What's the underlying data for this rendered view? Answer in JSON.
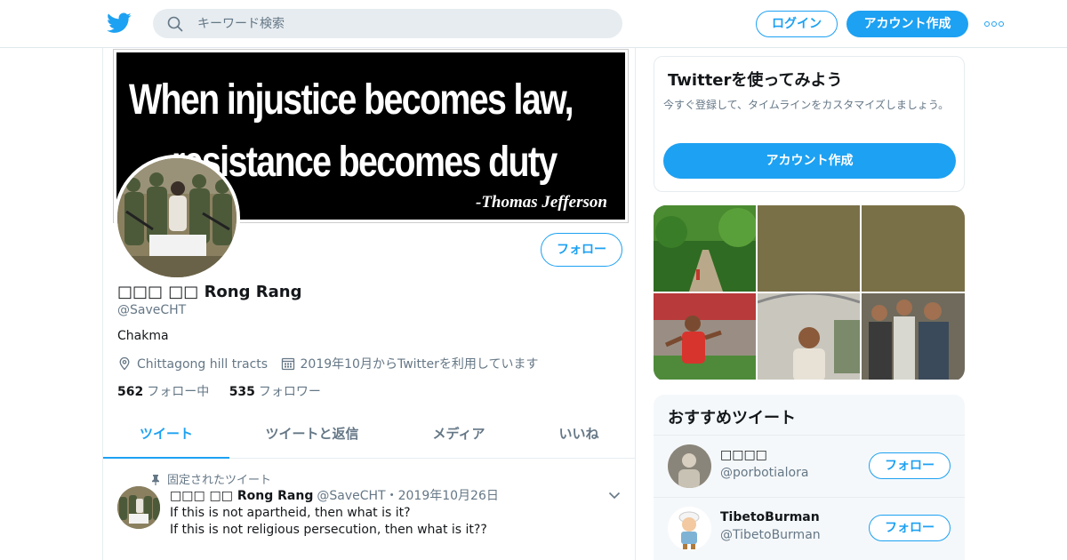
{
  "header": {
    "logo_icon": "twitter-bird-icon",
    "search_placeholder": "キーワード検索",
    "login_label": "ログイン",
    "signup_label": "アカウント作成",
    "more_icon": "more-dots-icon",
    "accent_color": "#1da1f2"
  },
  "banner": {
    "line1": "When injustice becomes law,",
    "line2": "resistance becomes duty",
    "signature": "-Thomas Jefferson"
  },
  "profile": {
    "display_name": "□□□ □□ Rong Rang",
    "handle": "@SaveCHT",
    "bio": "Chakma",
    "location": "Chittagong hill tracts",
    "joined": "2019年10月からTwitterを利用しています",
    "following_count": "562",
    "following_label": "フォロー中",
    "followers_count": "535",
    "followers_label": "フォロワー",
    "follow_label": "フォロー"
  },
  "tabs": [
    {
      "label": "ツイート",
      "active": true
    },
    {
      "label": "ツイートと返信",
      "active": false
    },
    {
      "label": "メディア",
      "active": false
    },
    {
      "label": "いいね",
      "active": false
    }
  ],
  "pinned_tweet": {
    "pinned_label": "固定されたツイート",
    "author_name": "□□□ □□ Rong Rang",
    "author_handle": "@SaveCHT",
    "date": "・2019年10月26日",
    "line1": "If this is not apartheid, then what is it?",
    "line2": "If this is not religious persecution, then what is it??"
  },
  "signup_card": {
    "title": "Twitterを使ってみよう",
    "description": "今すぐ登録して、タイムラインをカスタマイズしましょう。",
    "button_label": "アカウント作成"
  },
  "recommended": {
    "title": "おすすめツイート",
    "accounts": [
      {
        "name": "□□□□",
        "handle": "@porbotialora",
        "follow_label": "フォロー"
      },
      {
        "name": "TibetoBurman",
        "handle": "@TibetoBurman",
        "follow_label": "フォロー"
      }
    ]
  }
}
